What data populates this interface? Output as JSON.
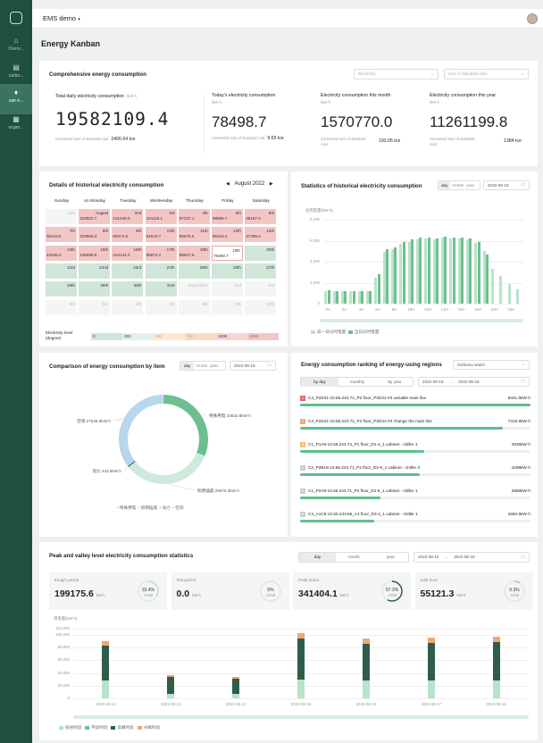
{
  "sidebar": {
    "items": [
      {
        "label": "Overv...",
        "icon": "home-icon"
      },
      {
        "label": "carbo...",
        "icon": "carbon-icon"
      },
      {
        "label": "use e...",
        "icon": "bulb-icon"
      },
      {
        "label": "organ...",
        "icon": "building-icon"
      }
    ]
  },
  "header": {
    "project": "EMS demo",
    "title": "Energy Kanban"
  },
  "comprehensive": {
    "title": "Comprehensive energy consumption",
    "select_type": "Electricity",
    "select_unit": "tons of standard coal",
    "metrics": [
      {
        "label": "Total daily electricity consumption",
        "unit": "/kW·h",
        "value": "19582109.4",
        "sub_label": "Converted tons of standard coal",
        "sub_value": "2406.64 tce"
      },
      {
        "label": "Today's electricity consumption",
        "unit": "/kW·h",
        "value": "78498.7",
        "sub_label": "Converted tons of standard coal",
        "sub_value": "9.65 tce"
      },
      {
        "label": "Electricity consumption this month",
        "unit": "/kW·h",
        "value": "1570770.0",
        "sub_label": "Converted tons of standard coal",
        "sub_value": "193.05 tce"
      },
      {
        "label": "Electricity consumption this year",
        "unit": "/kW·h",
        "value": "11261199.8",
        "sub_label": "Converted tons of standard coal",
        "sub_value": "1384 tce"
      }
    ]
  },
  "calendar": {
    "title": "Details of historical electricity consumption",
    "month": "August 2022",
    "weekdays": [
      "Sunday",
      "on Monday",
      "Tuesday",
      "Wednesday",
      "Thursday",
      "Friday",
      "Saturday"
    ],
    "cells": [
      [
        "31st",
        "",
        ""
      ],
      [
        "August",
        "103922.7",
        "r"
      ],
      [
        "2nd",
        "101246.0",
        "r"
      ],
      [
        "3rd",
        "101118.1",
        "r"
      ],
      [
        "4th",
        "87237.1",
        "r"
      ],
      [
        "5th",
        "98885.7",
        "r"
      ],
      [
        "6th",
        "45187.6",
        "r"
      ],
      [
        "7th",
        "36243.5",
        "r"
      ],
      [
        "8th",
        "103655.3",
        "r"
      ],
      [
        "9th",
        "95374.6",
        "r"
      ],
      [
        "10th",
        "94543.7",
        "r"
      ],
      [
        "11th",
        "95675.5",
        "r"
      ],
      [
        "12th",
        "95433.2",
        "r"
      ],
      [
        "13th",
        "47399.4",
        "r"
      ],
      [
        "14th",
        "42535.0",
        "r"
      ],
      [
        "15th",
        "108599.6",
        "r"
      ],
      [
        "16th",
        "104144.0",
        "r"
      ],
      [
        "17th",
        "98674.2",
        "r"
      ],
      [
        "18th",
        "98927.9",
        "r"
      ],
      [
        "19th",
        "78498.7",
        "s"
      ],
      [
        "20th",
        "",
        "g"
      ],
      [
        "21st",
        "",
        "g"
      ],
      [
        "22nd",
        "",
        "g"
      ],
      [
        "23rd",
        "",
        "g"
      ],
      [
        "24th",
        "",
        "g"
      ],
      [
        "25th",
        "",
        "g"
      ],
      [
        "26th",
        "",
        "g"
      ],
      [
        "27th",
        "",
        "g"
      ],
      [
        "28th",
        "",
        "g"
      ],
      [
        "29th",
        "",
        "g"
      ],
      [
        "30th",
        "",
        "g"
      ],
      [
        "31st",
        "",
        "g"
      ],
      [
        "September",
        "",
        ""
      ],
      [
        "2nd",
        "",
        ""
      ],
      [
        "3rd",
        "",
        ""
      ],
      [
        "4th",
        "",
        ""
      ],
      [
        "5th",
        "",
        ""
      ],
      [
        "6th",
        "",
        ""
      ],
      [
        "7th",
        "",
        ""
      ],
      [
        "8th",
        "",
        ""
      ],
      [
        "9th",
        "",
        ""
      ],
      [
        "10th",
        "",
        ""
      ]
    ],
    "level_label": "Electricity level (degree)",
    "levels": [
      "0",
      "250",
      "500",
      "750",
      "1000",
      "1250"
    ]
  },
  "statistics": {
    "title": "Statistics of historical electricity consumption",
    "tabs": [
      "day",
      "month",
      "year"
    ],
    "date": "2022-08-19",
    "yaxis_label": "总用电量(kW·h)",
    "legend": [
      "前一日分时电量",
      "当日分时电量"
    ]
  },
  "chart_data": [
    {
      "type": "bar",
      "yaxis_label": "总用电量(kW·h)",
      "ylim": [
        0,
        8000
      ],
      "yticks": [
        "0",
        "2,000",
        "4,000",
        "6,000",
        "8,000"
      ],
      "categories": [
        "0H",
        "1H",
        "2H",
        "3H",
        "4H",
        "5H",
        "6H",
        "7H",
        "8H",
        "9H",
        "10H",
        "11H",
        "12H",
        "13H",
        "14H",
        "15H",
        "16H",
        "17H",
        "18H",
        "19H",
        "20H",
        "21H",
        "22H",
        "23H"
      ],
      "xtick_labels": [
        "0H",
        "2H",
        "4H",
        "6H",
        "8H",
        "10H",
        "12H",
        "14H",
        "16H",
        "18H",
        "20H",
        "22H"
      ],
      "series": [
        {
          "name": "前一日分时电量",
          "values": [
            1200,
            1150,
            1180,
            1170,
            1190,
            1180,
            2500,
            4900,
            5200,
            5700,
            5900,
            6100,
            6200,
            6100,
            6300,
            6200,
            6200,
            6100,
            5800,
            5000,
            3300,
            2600,
            1900,
            1400
          ]
        },
        {
          "name": "当日分时电量",
          "values": [
            1250,
            1200,
            1200,
            1190,
            1200,
            1200,
            2800,
            5200,
            5400,
            5900,
            6100,
            6300,
            6300,
            6200,
            6400,
            6300,
            6300,
            6200,
            5900,
            4700,
            0,
            0,
            0,
            0
          ]
        }
      ]
    },
    {
      "type": "pie",
      "title": "Comparison of energy consumption by item",
      "slices": [
        {
          "name": "特殊用电",
          "value": 24532.8,
          "label": "特殊用电 24532.8kW·h"
        },
        {
          "name": "照明插座",
          "value": 25976.3,
          "label": "照明插座 25976.3kW·h"
        },
        {
          "name": "动力",
          "value": 443.5,
          "label": "动力 443.5kW·h"
        },
        {
          "name": "空调",
          "value": 27545.6,
          "label": "空调 27545.6kW·h"
        }
      ]
    },
    {
      "type": "bar",
      "title": "Peak and valley level electricity consumption statistics",
      "yaxis_label": "用电量(kW·h)",
      "ylim": [
        0,
        110000
      ],
      "yticks": [
        "0",
        "20,000",
        "40,000",
        "60,000",
        "80,000",
        "100,000",
        "110,000"
      ],
      "categories": [
        "2022-08-12",
        "2022-08-13",
        "2022-08-14",
        "2022-08-15",
        "2022-08-16",
        "2022-08-17",
        "2022-08-18"
      ],
      "series": [
        {
          "name": "低谷时段",
          "values": [
            28000,
            7000,
            6500,
            29000,
            28500,
            28000,
            28500
          ]
        },
        {
          "name": "平段时段",
          "values": [
            0,
            0,
            0,
            0,
            0,
            0,
            0
          ]
        },
        {
          "name": "高峰时段",
          "values": [
            55000,
            27000,
            24500,
            66000,
            58000,
            60000,
            61000
          ]
        },
        {
          "name": "尖峰时段",
          "values": [
            7500,
            2500,
            2300,
            8500,
            8500,
            8000,
            8200
          ]
        }
      ]
    }
  ],
  "itemized": {
    "title": "Comparison of energy consumption by item",
    "tabs": [
      "day",
      "month",
      "year"
    ],
    "date": "2022-08-19",
    "legend": [
      "特殊用电",
      "照明插座",
      "动力",
      "空调"
    ]
  },
  "ranking": {
    "title": "Energy consumption ranking of energy-using regions",
    "select": "Ordinary watch",
    "tabs": [
      "by day",
      "monthly",
      "by year"
    ],
    "date_from": "2022-08-19",
    "date_to": "2022-08-19",
    "items": [
      {
        "rank": "1",
        "name": "C3_P2D31-10.65.243.71_P2 floor_P2D31-#3 variable main line",
        "value": "8341.5kW·h",
        "pct": 1.0
      },
      {
        "rank": "2",
        "name": "C3_P2D41-10.65.243.71_P2 floor_P2D41-#4 change the main line",
        "value": "7319.6kW·h",
        "pct": 0.88
      },
      {
        "rank": "3",
        "name": "C1_P1A5-10.65.243.74_P1 floor_D1-4_1 cabinet - chiller 1",
        "value": "4536kW·h",
        "pct": 0.54
      },
      {
        "rank": "4",
        "name": "C2_P2B19-10.65.243.71_P2 floor_D2-6_1 cabinet - chiller 2",
        "value": "4299kW·h",
        "pct": 0.52
      },
      {
        "rank": "5",
        "name": "C1_P2A8-10.65.243.71_P2 floor_D1-6_1 cabinet - chiller 1",
        "value": "2886kW·h",
        "pct": 0.35
      },
      {
        "rank": "6",
        "name": "C3_A1C5-10.65.243.86_A1 floor_D3-4_1 cabinet - chiller 1",
        "value": "2650.5kW·h",
        "pct": 0.32
      }
    ]
  },
  "peak": {
    "title": "Peak and valley level electricity consumption statistics",
    "tabs": [
      "day",
      "month",
      "year"
    ],
    "date_from": "2022-08-12",
    "date_to": "2022-08-18",
    "unit": "kW·h",
    "ring_caption": "占总电量",
    "periods": [
      {
        "label": "trough period",
        "value": "199175.6",
        "pct": "33.4%",
        "frac": 0.334,
        "color": "#b9e3c9"
      },
      {
        "label": "Flat period",
        "value": "0.0",
        "pct": "0%",
        "frac": 0,
        "color": "#6cc08f"
      },
      {
        "label": "Peak hours",
        "value": "341404.1",
        "pct": "57.3%",
        "frac": 0.573,
        "color": "#2f5d4c"
      },
      {
        "label": "rush hour",
        "value": "55121.3",
        "pct": "9.3%",
        "frac": 0.093,
        "color": "#f0a772"
      }
    ],
    "legend": [
      "低谷时段",
      "平段时段",
      "高峰时段",
      "尖峰时段"
    ]
  },
  "colors": {
    "sidebar": "#1f4f3f",
    "accent": "#5fbf8f",
    "dark_green": "#2f5d4c",
    "light_green": "#b9e3c9",
    "orange": "#f0a772",
    "pink": "#f3c6c6"
  }
}
